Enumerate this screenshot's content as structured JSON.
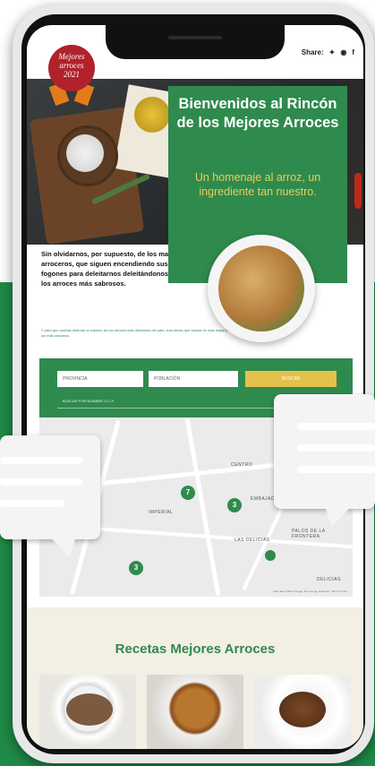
{
  "header": {
    "share_label": "Share:",
    "share_icons": [
      "twitter-icon",
      "instagram-icon",
      "facebook-icon"
    ]
  },
  "badge": {
    "line1": "Mejores",
    "line2": "arroces",
    "line3": "2021"
  },
  "hero": {
    "title": "Bienvenidos al Rincón de los Mejores Arroces",
    "subtitle": "Un homenaje al arroz, un ingrediente tan nuestro."
  },
  "intro": {
    "text": "Sin olvidarnos, por supuesto, de los maestros arroceros, que siguen encendiendo sus fogones para deleitarnos deleitándonos con los arroces más sabrosos.",
    "note": "Y para que puedas disfrutar al máximo de los arroces más deliciosos del país, solo tienes que buscar en este mapa y localizar los más cercanos."
  },
  "search": {
    "provincia_placeholder": "PROVINCIA",
    "poblacion_placeholder": "POBLACIÓN",
    "button_label": "BUSCAR",
    "name_placeholder": "BUSCAR POR NOMBRE O C.P."
  },
  "map": {
    "labels": [
      "CENTRO",
      "IMPERIAL",
      "EMBAJADORES",
      "LAS DELICIAS",
      "PALOS DE LA FRONTERA",
      "DELICIAS"
    ],
    "pins": [
      "7",
      "3",
      "3"
    ],
    "footer": "Map data ©2021 Google, Inst. Geogr. Nacional · Terms of Use"
  },
  "recetas": {
    "title": "Recetas Mejores Arroces"
  },
  "colors": {
    "brand_green": "#2f8a4e",
    "accent_yellow": "#e4c14d",
    "badge_red": "#b1222a",
    "background_green": "#1f8a47"
  }
}
